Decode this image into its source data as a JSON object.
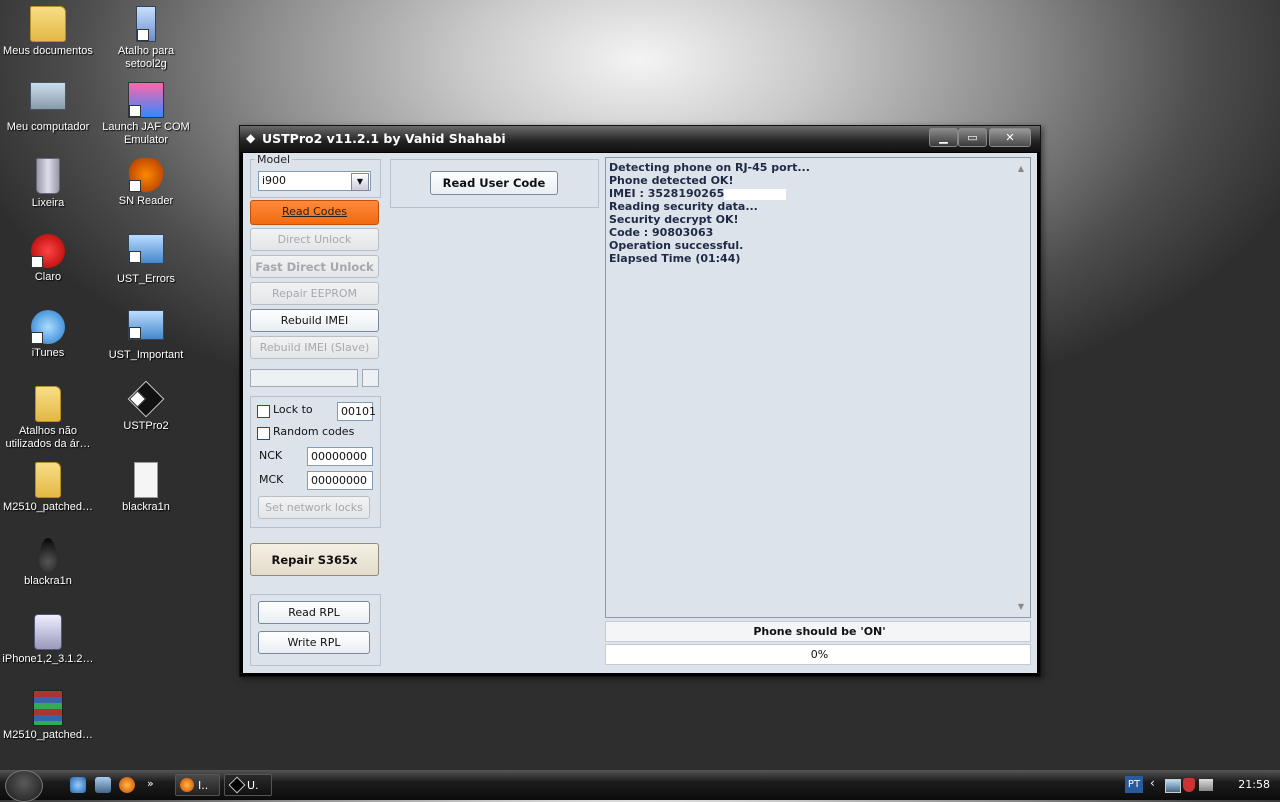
{
  "desktop": {
    "icons": [
      {
        "label": "Meus documentos",
        "icon": "folder-icon"
      },
      {
        "label": "Atalho para setool2g",
        "icon": "shortcut-icon"
      },
      {
        "label": "Meu computador",
        "icon": "computer-icon"
      },
      {
        "label": "Launch JAF COM Emulator",
        "icon": "app-icon"
      },
      {
        "label": "Lixeira",
        "icon": "trash-icon"
      },
      {
        "label": "SN Reader",
        "icon": "butterfly-icon"
      },
      {
        "label": "Claro",
        "icon": "claro-icon"
      },
      {
        "label": "UST_Errors",
        "icon": "image-icon"
      },
      {
        "label": "iTunes",
        "icon": "itunes-icon"
      },
      {
        "label": "UST_Important",
        "icon": "image-icon"
      },
      {
        "label": "Atalhos não utilizados da ár…",
        "icon": "folder-icon"
      },
      {
        "label": "USTPro2",
        "icon": "ustpro2-icon"
      },
      {
        "label": "M2510_patched…",
        "icon": "folder-icon"
      },
      {
        "label": "blackra1n",
        "icon": "file-icon"
      },
      {
        "label": "blackra1n",
        "icon": "drop-icon"
      },
      {
        "label": "iPhone1,2_3.1.2…",
        "icon": "package-icon"
      },
      {
        "label": "M2510_patched…",
        "icon": "rar-icon"
      }
    ]
  },
  "window": {
    "title": "USTPro2 v11.2.1   by Vahid Shahabi",
    "minimize": "▁",
    "maximize": "▭",
    "close": "✕"
  },
  "left_panel": {
    "model_label": "Model",
    "model_value": "i900",
    "read_codes": "Read Codes",
    "direct_unlock": "Direct Unlock",
    "fast_direct_unlock": "Fast Direct Unlock",
    "repair_eeprom": "Repair EEPROM",
    "rebuild_imei": "Rebuild IMEI",
    "rebuild_imei_slave": "Rebuild IMEI (Slave)",
    "lock_to_label": "Lock to",
    "lock_to_value": "00101",
    "random_codes_label": "Random codes",
    "nck_label": "NCK",
    "nck_value": "00000000",
    "mck_label": "MCK",
    "mck_value": "00000000",
    "set_network_locks": "Set network locks",
    "repair_s365x": "Repair S365x",
    "read_rpl": "Read RPL",
    "write_rpl": "Write RPL"
  },
  "middle_panel": {
    "read_user_code": "Read User Code"
  },
  "log": {
    "lines": [
      "Detecting phone on RJ-45 port...",
      "Phone detected OK!",
      "IMEI : 3528190265",
      "Reading security data...",
      "Security decrypt OK!",
      "Code : 90803063",
      "Operation successful.",
      "Elapsed Time (01:44)"
    ]
  },
  "status": {
    "message": "Phone should be 'ON'",
    "progress_text": "0%",
    "progress": 0
  },
  "taskbar": {
    "items": [
      {
        "label": "I..",
        "icon": "firefox-icon"
      },
      {
        "label": "U.",
        "icon": "ustpro2-icon"
      }
    ],
    "language": "PT",
    "clock": "21:58",
    "quicklaunch_more": "»"
  }
}
